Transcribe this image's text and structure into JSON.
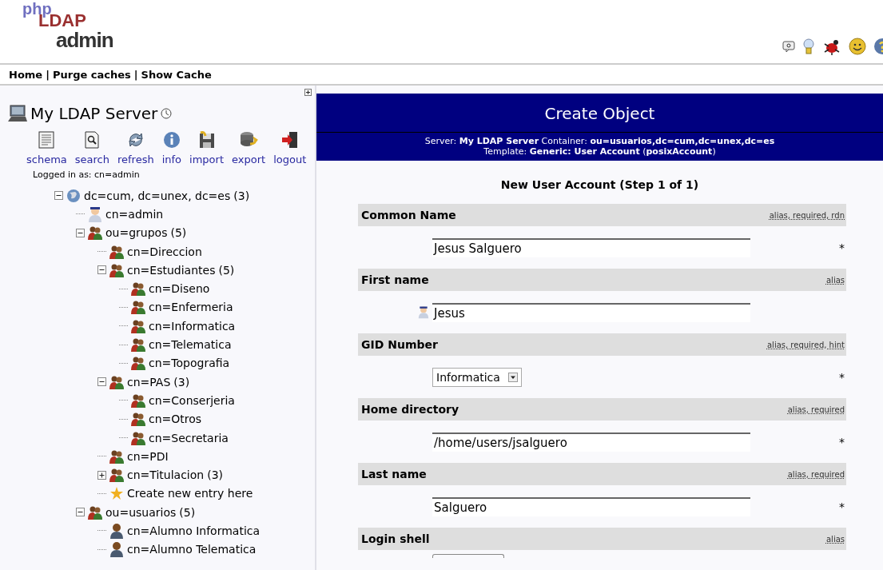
{
  "logo": {
    "parts": [
      "php",
      "LDAP",
      "admin"
    ]
  },
  "header_icons": [
    {
      "kind": "help"
    },
    {
      "kind": "bulb"
    },
    {
      "kind": "bug"
    },
    {
      "kind": "smiley"
    },
    {
      "kind": "question"
    }
  ],
  "nav": [
    {
      "label": "Home"
    },
    {
      "label": "Purge caches"
    },
    {
      "label": "Show Cache"
    }
  ],
  "nav_separator": "|",
  "server": {
    "name": "My LDAP Server",
    "logged_in": "Logged in as: cn=admin"
  },
  "toolbar": [
    {
      "label": "schema",
      "kind": "schema"
    },
    {
      "label": "search",
      "kind": "search"
    },
    {
      "label": "refresh",
      "kind": "refresh"
    },
    {
      "label": "info",
      "kind": "info"
    },
    {
      "label": "import",
      "kind": "import"
    },
    {
      "label": "export",
      "kind": "export"
    },
    {
      "label": "logout",
      "kind": "logout"
    }
  ],
  "tree": [
    {
      "label": "dc=cum, dc=unex, dc=es",
      "count": "(3)",
      "kind": "globe",
      "expanded": true,
      "children": [
        {
          "label": "cn=admin",
          "kind": "admin"
        },
        {
          "label": "ou=grupos",
          "count": "(5)",
          "kind": "group",
          "expanded": true,
          "children": [
            {
              "label": "cn=Direccion",
              "kind": "group"
            },
            {
              "label": "cn=Estudiantes",
              "count": "(5)",
              "kind": "group",
              "expanded": true,
              "children": [
                {
                  "label": "cn=Diseno",
                  "kind": "group"
                },
                {
                  "label": "cn=Enfermeria",
                  "kind": "group"
                },
                {
                  "label": "cn=Informatica",
                  "kind": "group"
                },
                {
                  "label": "cn=Telematica",
                  "kind": "group"
                },
                {
                  "label": "cn=Topografia",
                  "kind": "group"
                }
              ]
            },
            {
              "label": "cn=PAS",
              "count": "(3)",
              "kind": "group",
              "expanded": true,
              "children": [
                {
                  "label": "cn=Conserjeria",
                  "kind": "group"
                },
                {
                  "label": "cn=Otros",
                  "kind": "group"
                },
                {
                  "label": "cn=Secretaria",
                  "kind": "group"
                }
              ]
            },
            {
              "label": "cn=PDI",
              "kind": "group"
            },
            {
              "label": "cn=Titulacion",
              "count": "(3)",
              "kind": "group",
              "expanded": false
            },
            {
              "label": "Create new entry here",
              "kind": "create"
            }
          ]
        },
        {
          "label": "ou=usuarios",
          "count": "(5)",
          "kind": "group",
          "expanded": true,
          "children": [
            {
              "label": "cn=Alumno Informatica",
              "kind": "user"
            },
            {
              "label": "cn=Alumno Telematica",
              "kind": "user"
            }
          ]
        }
      ]
    }
  ],
  "page": {
    "title": "Create Object",
    "info_line_1": "Server: **My LDAP Server**   Container: **ou=usuarios,dc=cum,dc=unex,dc=es**",
    "info_line_2": "Template: **Generic: User Account** (**posixAccount**)",
    "form_title": "New User Account (Step 1 of 1)"
  },
  "fields": [
    {
      "label": "Common Name",
      "flags": "alias, required, rdn",
      "kind": "text",
      "value": "Jesus Salguero",
      "marker": "*"
    },
    {
      "label": "First name",
      "flags": "alias",
      "kind": "text",
      "value": "Jesus",
      "avatar": true
    },
    {
      "label": "GID Number",
      "flags": "alias, required, hint",
      "kind": "select",
      "value": "Informatica",
      "marker": "*"
    },
    {
      "label": "Home directory",
      "flags": "alias, required",
      "kind": "text",
      "value": "/home/users/jsalguero",
      "marker": "*"
    },
    {
      "label": "Last name",
      "flags": "alias, required",
      "kind": "text",
      "value": "Salguero",
      "marker": "*"
    },
    {
      "label": "Login shell",
      "flags": "alias",
      "kind": "cut"
    }
  ]
}
